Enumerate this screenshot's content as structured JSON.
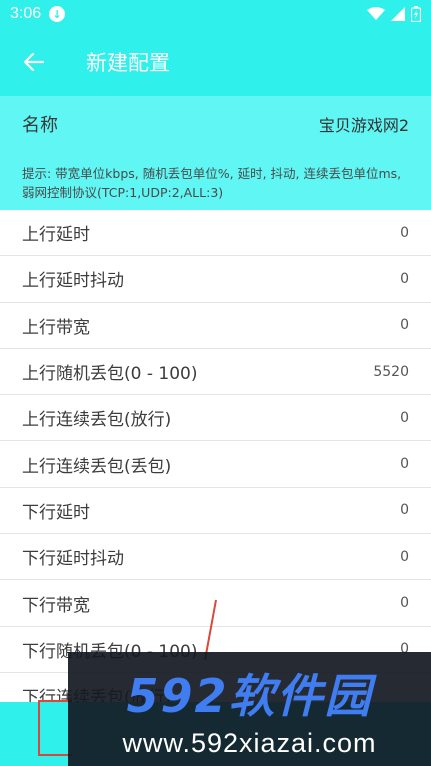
{
  "status_bar": {
    "time": "3:06",
    "download_glyph": "↓",
    "battery_glyph": "ϟ",
    "icons": [
      "download-icon",
      "wifi-icon",
      "signal-icon",
      "battery-charging-icon"
    ]
  },
  "toolbar": {
    "title": "新建配置",
    "back_icon": "arrow-left-icon"
  },
  "name_field": {
    "label": "名称",
    "value": "宝贝游戏网2"
  },
  "hint": "提示: 带宽单位kbps, 随机丢包单位%, 延时, 抖动, 连续丢包单位ms, 弱网控制协议(TCP:1,UDP:2,ALL:3)",
  "settings": [
    {
      "label": "上行延时",
      "value": "0"
    },
    {
      "label": "上行延时抖动",
      "value": "0"
    },
    {
      "label": "上行带宽",
      "value": "0"
    },
    {
      "label": "上行随机丢包(0 - 100)",
      "value": "5520"
    },
    {
      "label": "上行连续丢包(放行)",
      "value": "0"
    },
    {
      "label": "上行连续丢包(丢包)",
      "value": "0"
    },
    {
      "label": "下行延时",
      "value": "0"
    },
    {
      "label": "下行延时抖动",
      "value": "0"
    },
    {
      "label": "下行带宽",
      "value": "0"
    },
    {
      "label": "下行随机丢包(0 - 100)",
      "value": "0"
    },
    {
      "label": "下行连续丢包(放行)",
      "value": ""
    }
  ],
  "watermark": {
    "brand": "592软件园",
    "url": "www.592xiazai.com"
  },
  "colors": {
    "accent": "#2ff0ea",
    "accent_light": "#5ff6f3",
    "annotation": "#d9483a"
  }
}
